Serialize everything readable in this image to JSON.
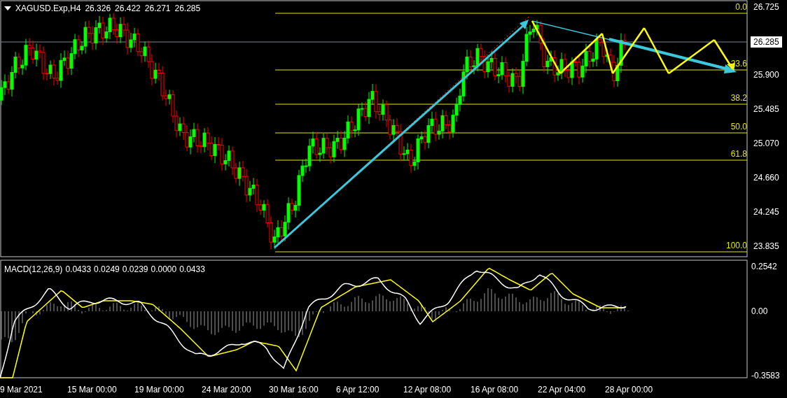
{
  "symbol_header": {
    "symbol": "XAGUSD.Exp,H4",
    "ohlc": [
      "26.326",
      "26.422",
      "26.271",
      "26.285"
    ]
  },
  "price_axis": {
    "ticks": [
      "26.725",
      "25.900",
      "25.485",
      "25.070",
      "24.660",
      "24.245",
      "23.835"
    ],
    "current_price": "26.285"
  },
  "fibonacci_levels": [
    {
      "label": "0.0"
    },
    {
      "label": "23.6"
    },
    {
      "label": "38.2"
    },
    {
      "label": "50.0"
    },
    {
      "label": "61.8"
    },
    {
      "label": "100.0"
    }
  ],
  "macd": {
    "title": "MACD(12,26,9)",
    "values": [
      "0.0433",
      "0.0249",
      "0.0239",
      "0.0000",
      "0.0433"
    ],
    "axis_ticks": [
      "0.2542",
      "0.00",
      "-0.3583"
    ]
  },
  "time_axis": {
    "labels": [
      "9 Mar 2021",
      "15 Mar 00:00",
      "19 Mar 00:00",
      "24 Mar 20:00",
      "30 Mar 16:00",
      "6 Apr 12:00",
      "12 Apr 08:00",
      "16 Apr 08:00",
      "22 Apr 04:00",
      "28 Apr 00:00"
    ]
  }
}
